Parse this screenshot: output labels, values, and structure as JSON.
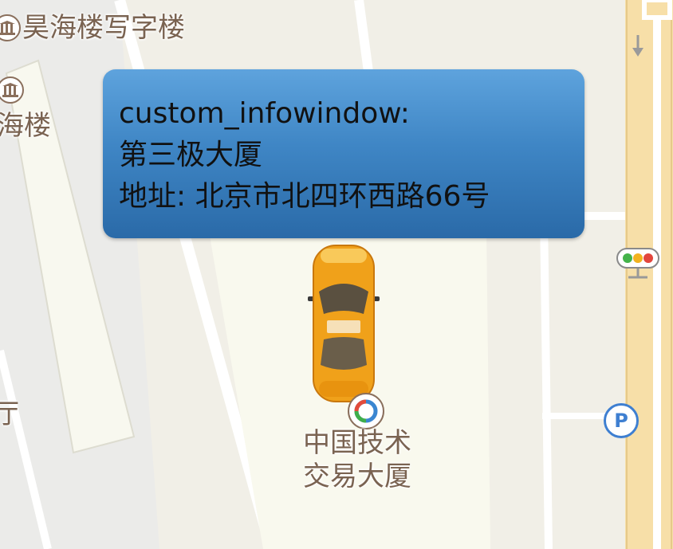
{
  "map": {
    "poi_labels": {
      "building_top": "昊海楼写字楼",
      "building_left": "海楼",
      "partial_left": "厅",
      "tech_center_line1": "中国技术",
      "tech_center_line2": "交易大厦"
    },
    "infowindow": {
      "title": "custom_infowindow:",
      "name": "第三极大厦",
      "address": "地址: 北京市北四环西路66号"
    },
    "parking_label": "P",
    "icons": {
      "building": "building-icon",
      "parking": "parking-icon",
      "traffic_light": "traffic-light-icon",
      "car_marker": "taxi-car-marker",
      "poi": "trade-center-icon",
      "lane_arrow": "down-arrow-icon"
    },
    "colors": {
      "background": "#f1efe7",
      "road": "#ffffff",
      "highway": "#f7dfa8",
      "infowindow": "#3f86c5",
      "label": "#7a6351",
      "parking": "#3e7fd1",
      "car": "#f5a51c"
    }
  }
}
